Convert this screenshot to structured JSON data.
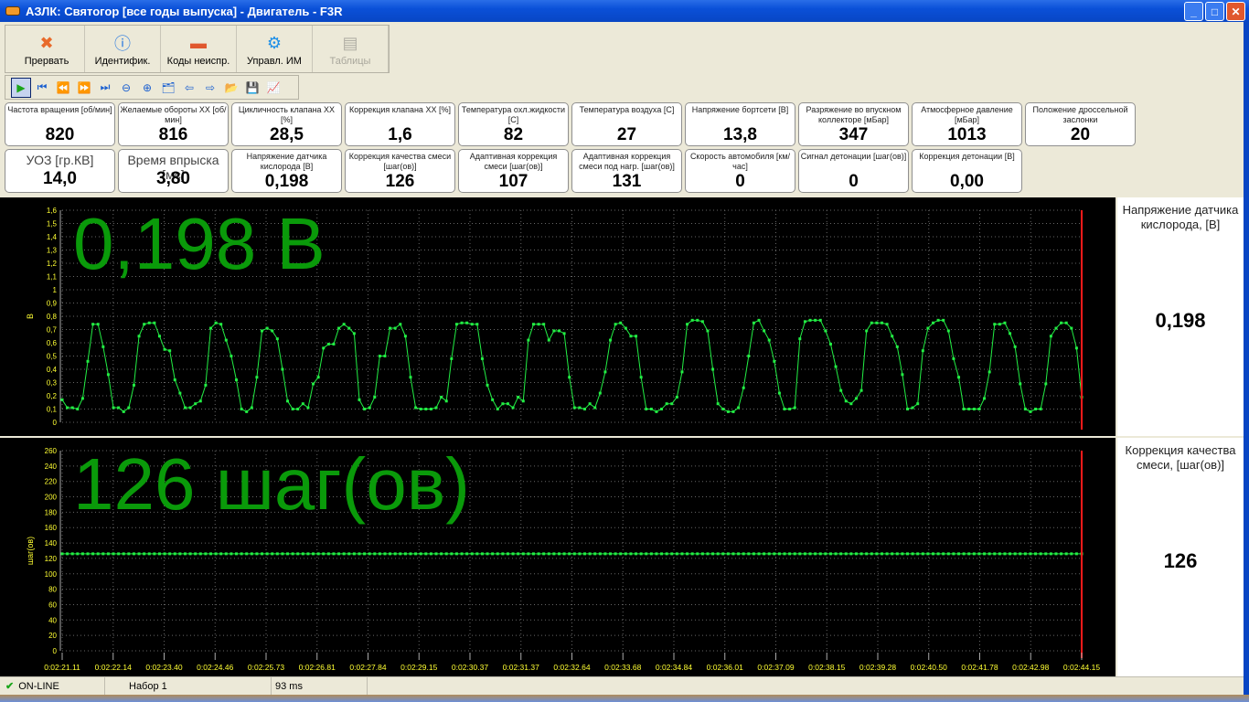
{
  "window": {
    "title": "АЗЛК: Святогор [все годы выпуска] - Двигатель - F3R"
  },
  "toolbar": [
    {
      "label": "Прервать",
      "icon": "disconnect-icon",
      "enabled": true
    },
    {
      "label": "Идентифик.",
      "icon": "info-icon",
      "enabled": true
    },
    {
      "label": "Коды неиспр.",
      "icon": "engine-icon",
      "enabled": true
    },
    {
      "label": "Управл. ИМ",
      "icon": "gear-icon",
      "enabled": true
    },
    {
      "label": "Таблицы",
      "icon": "table-icon",
      "enabled": false
    }
  ],
  "playback": [
    {
      "icon": "play-icon",
      "glyph": "▶"
    },
    {
      "icon": "skip-first-icon",
      "glyph": "⏮"
    },
    {
      "icon": "rewind-icon",
      "glyph": "⏪"
    },
    {
      "icon": "fast-forward-icon",
      "glyph": "⏩"
    },
    {
      "icon": "skip-last-icon",
      "glyph": "⏭"
    },
    {
      "icon": "zoom-out-icon",
      "glyph": "⊖"
    },
    {
      "icon": "zoom-in-icon",
      "glyph": "⊕"
    },
    {
      "icon": "folders-icon",
      "glyph": "🗂"
    },
    {
      "icon": "import-icon",
      "glyph": "⇦"
    },
    {
      "icon": "export-icon",
      "glyph": "⇨"
    },
    {
      "icon": "open-folder-icon",
      "glyph": "📂"
    },
    {
      "icon": "save-icon",
      "glyph": "💾"
    },
    {
      "icon": "chart-icon",
      "glyph": "📈"
    }
  ],
  "params": [
    {
      "label": "Частота вращения [об/мин]",
      "value": "820"
    },
    {
      "label": "Желаемые обороты ХХ [об/мин]",
      "value": "816"
    },
    {
      "label": "Цикличность клапана ХХ [%]",
      "value": "28,5"
    },
    {
      "label": "Коррекция клапана ХХ [%]",
      "value": "1,6"
    },
    {
      "label": "Температура охл.жидкости [С]",
      "value": "82"
    },
    {
      "label": "Температура воздуха [С]",
      "value": "27"
    },
    {
      "label": "Напряжение бортсети [В]",
      "value": "13,8"
    },
    {
      "label": "Разряжение во впускном коллекторе [мБар]",
      "value": "347"
    },
    {
      "label": "Атмосферное давление [мБар]",
      "value": "1013"
    },
    {
      "label": "Положение дроссельной заслонки",
      "value": "20"
    },
    {
      "label": "УОЗ [гр.КВ]",
      "value": "14,0",
      "big": true
    },
    {
      "label": "Время впрыска [мс]",
      "value": "3,80",
      "big": true
    },
    {
      "label": "Напряжение датчика кислорода [В]",
      "value": "0,198"
    },
    {
      "label": "Коррекция качества смеси [шаг(ов)]",
      "value": "126"
    },
    {
      "label": "Адаптивная коррекция смеси [шаг(ов)]",
      "value": "107"
    },
    {
      "label": "Адаптивная коррекция смеси под нагр. [шаг(ов)]",
      "value": "131"
    },
    {
      "label": "Скорость автомобиля [км/час]",
      "value": "0"
    },
    {
      "label": "Сигнал детонации [шаг(ов)]",
      "value": "0"
    },
    {
      "label": "Коррекция детонации [В]",
      "value": "0,00"
    }
  ],
  "chart_data": [
    {
      "type": "line",
      "overlay": "0,198 В",
      "ylabel": "В",
      "ylim": [
        0,
        1.6
      ],
      "ystep": 0.1,
      "side_title": "Напряжение датчика кислорода, [В]",
      "side_value": "0,198",
      "color": "#22ee44",
      "values": [
        0.17,
        0.11,
        0.11,
        0.1,
        0.18,
        0.46,
        0.74,
        0.74,
        0.57,
        0.36,
        0.11,
        0.11,
        0.08,
        0.11,
        0.28,
        0.65,
        0.74,
        0.75,
        0.75,
        0.65,
        0.55,
        0.54,
        0.32,
        0.22,
        0.11,
        0.11,
        0.14,
        0.16,
        0.28,
        0.71,
        0.75,
        0.74,
        0.62,
        0.5,
        0.32,
        0.1,
        0.08,
        0.11,
        0.34,
        0.69,
        0.71,
        0.69,
        0.63,
        0.4,
        0.16,
        0.1,
        0.1,
        0.14,
        0.11,
        0.29,
        0.34,
        0.56,
        0.59,
        0.59,
        0.71,
        0.74,
        0.71,
        0.67,
        0.17,
        0.1,
        0.11,
        0.19,
        0.5,
        0.5,
        0.71,
        0.71,
        0.74,
        0.65,
        0.34,
        0.11,
        0.1,
        0.1,
        0.1,
        0.11,
        0.19,
        0.16,
        0.48,
        0.74,
        0.75,
        0.75,
        0.74,
        0.74,
        0.48,
        0.28,
        0.17,
        0.1,
        0.14,
        0.14,
        0.11,
        0.19,
        0.16,
        0.62,
        0.74,
        0.74,
        0.74,
        0.62,
        0.69,
        0.69,
        0.67,
        0.34,
        0.11,
        0.11,
        0.1,
        0.14,
        0.11,
        0.22,
        0.38,
        0.62,
        0.74,
        0.75,
        0.71,
        0.65,
        0.65,
        0.34,
        0.1,
        0.1,
        0.08,
        0.1,
        0.14,
        0.14,
        0.19,
        0.38,
        0.74,
        0.77,
        0.77,
        0.76,
        0.69,
        0.4,
        0.14,
        0.1,
        0.08,
        0.08,
        0.11,
        0.26,
        0.5,
        0.75,
        0.77,
        0.69,
        0.62,
        0.46,
        0.22,
        0.1,
        0.1,
        0.11,
        0.63,
        0.76,
        0.77,
        0.77,
        0.77,
        0.69,
        0.59,
        0.42,
        0.24,
        0.16,
        0.14,
        0.18,
        0.24,
        0.69,
        0.75,
        0.75,
        0.75,
        0.74,
        0.65,
        0.57,
        0.36,
        0.1,
        0.11,
        0.14,
        0.54,
        0.71,
        0.75,
        0.77,
        0.77,
        0.69,
        0.48,
        0.34,
        0.1,
        0.1,
        0.1,
        0.1,
        0.18,
        0.38,
        0.74,
        0.74,
        0.75,
        0.67,
        0.57,
        0.29,
        0.1,
        0.08,
        0.1,
        0.1,
        0.29,
        0.65,
        0.71,
        0.75,
        0.75,
        0.71,
        0.56,
        0.19
      ]
    },
    {
      "type": "line",
      "overlay": "126 шаг(ов)",
      "ylabel": "шаг(ов)",
      "ylim": [
        0,
        260
      ],
      "ystep": 20,
      "side_title": "Коррекция качества смеси, [шаг(ов)]",
      "side_value": "126",
      "color": "#22ee44",
      "constant_value": 126,
      "xticks": [
        "0:02:21.11",
        "0:02:22.14",
        "0:02:23.40",
        "0:02:24.46",
        "0:02:25.73",
        "0:02:26.81",
        "0:02:27.84",
        "0:02:29.15",
        "0:02:30.37",
        "0:02:31.37",
        "0:02:32.64",
        "0:02:33.68",
        "0:02:34.84",
        "0:02:36.01",
        "0:02:37.09",
        "0:02:38.15",
        "0:02:39.28",
        "0:02:40.50",
        "0:02:41.78",
        "0:02:42.98",
        "0:02:44.15"
      ]
    }
  ],
  "status": {
    "connection": "ON-LINE",
    "set": "Набор 1",
    "interval": "93 ms"
  }
}
